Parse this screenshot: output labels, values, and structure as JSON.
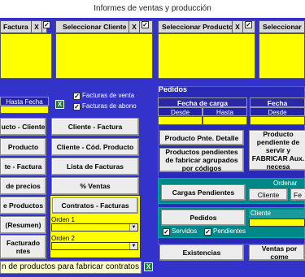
{
  "window": {
    "title": "Informes de ventas y producción"
  },
  "selectors": {
    "factura": {
      "label": "Factura",
      "x": "X",
      "checked": true
    },
    "cliente": {
      "label": "Seleccionar Cliente",
      "x": "X",
      "checked": true
    },
    "producto": {
      "label": "Seleccionar Producto",
      "x": "X",
      "checked": true
    },
    "more": {
      "label": "Seleccionar"
    }
  },
  "dates": {
    "hasta_fecha": "Hasta Fecha"
  },
  "options": {
    "facturas_venta": "Facturas de venta",
    "facturas_abono": "Facturas de abono"
  },
  "left_buttons": [
    "ucto - Cliente",
    "Producto",
    "te - Factura",
    "de precios",
    "e Productos",
    "(Resumen)",
    "Facturado",
    "ntes"
  ],
  "mid_buttons": {
    "cliente_factura": "Cliente - Factura",
    "cliente_cod_producto": "Cliente - Cód. Producto",
    "lista_facturas": "Lista de Facturas",
    "pct_ventas": "% Ventas",
    "contratos_facturas": "Contratos - Facturas",
    "orden1": "Orden 1",
    "orden2": "Orden 2"
  },
  "pedidos": {
    "title": "Pedidos",
    "fecha_carga": "Fecha de carga",
    "fecha_propuesta": "Fecha propuesta",
    "desde": "Desde",
    "hasta": "Hasta",
    "producto_pnte_detalle": "Producto Pnte. Detalle",
    "producto_pendiente_servir": "Producto pendiente de servir y FABRICAR Aux. necesa",
    "productos_pendientes_fabricar": "Productos pendientes de fabricar agrupados por códigos",
    "cargas_pendientes": "Cargas Pendientes",
    "ordenar_por": "Ordenar por",
    "cliente_btn": "Cliente",
    "fecha_btn": "Fe",
    "pedidos_btn": "Pedidos",
    "cliente_label": "Cliente",
    "servidos": "Servidos",
    "pendientes": "Pendientes"
  },
  "bottom": {
    "existencias": "Existencias",
    "ventas_por_comercial": "Ventas por come",
    "status_text": "n de productos para fabricar contratos"
  },
  "colors": {
    "form_bg": "#3333cc",
    "yellow": "#ffff00",
    "teal": "#008888"
  }
}
